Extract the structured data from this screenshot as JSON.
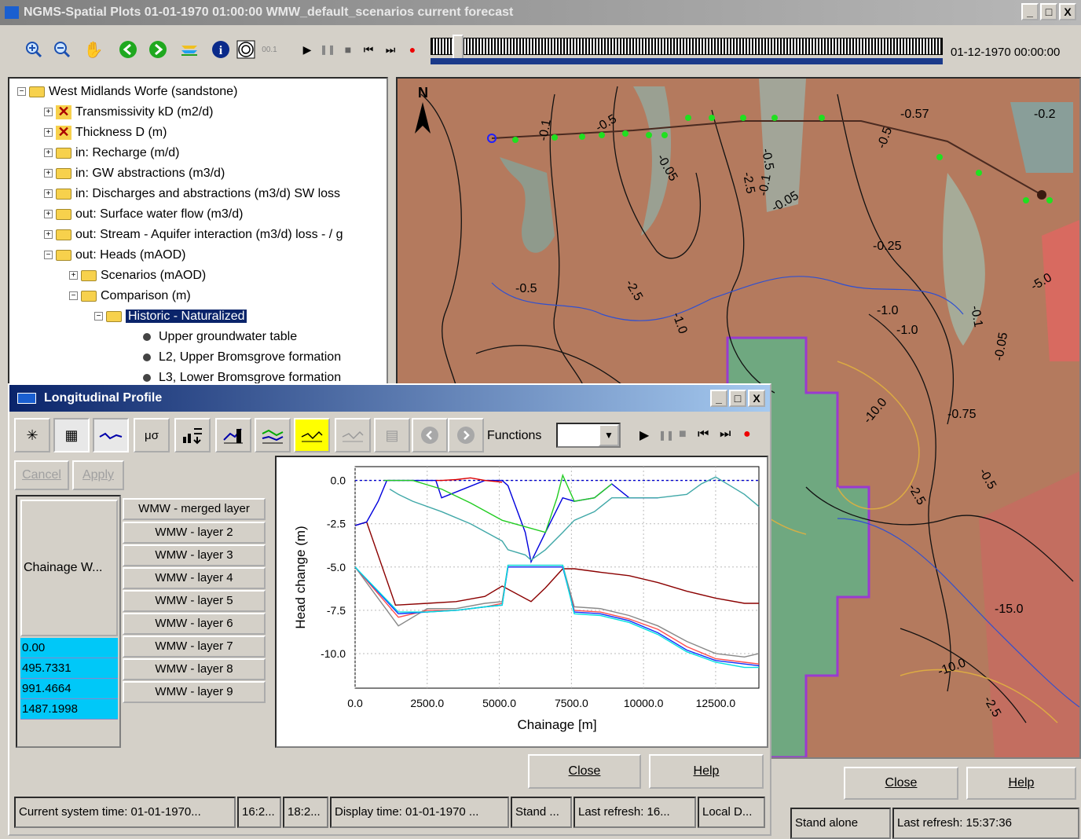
{
  "window": {
    "title": "NGMS-Spatial Plots 01-01-1970 01:00:00 WMW_default_scenarios current forecast",
    "minimize": "_",
    "maximize": "□",
    "close": "X"
  },
  "toolbar": {
    "end_date": "01-12-1970 00:00:00",
    "scale_label": "00.1"
  },
  "tree": {
    "root": "West Midlands Worfe (sandstone)",
    "items": [
      {
        "label": "Transmissivity kD (m2/d)"
      },
      {
        "label": "Thickness D (m)"
      },
      {
        "label": "in: Recharge (m/d)"
      },
      {
        "label": "in: GW abstractions (m3/d)"
      },
      {
        "label": "in: Discharges and abstractions (m3/d) SW loss"
      },
      {
        "label": "out: Surface water flow (m3/d)"
      },
      {
        "label": "out: Stream - Aquifer interaction (m3/d) loss - / g"
      },
      {
        "label": "out: Heads (mAOD)"
      },
      {
        "label": "Scenarios (mAOD)"
      },
      {
        "label": "Comparison (m)"
      },
      {
        "label": "Historic - Naturalized"
      },
      {
        "label": "Upper groundwater table"
      },
      {
        "label": "L2, Upper Bromsgrove formation"
      },
      {
        "label": "L3, Lower Bromsgrove formation"
      }
    ]
  },
  "map": {
    "north": "N",
    "labels": [
      "-0.1",
      "-0.5",
      "-0.05",
      "-0.5",
      "-2.5",
      "-0.1",
      "-0.05",
      "-0.5",
      "-0.57",
      "-0.2",
      "-0.25",
      "-0.5",
      "-2.5",
      "-1.0",
      "-1.0",
      "-1.0",
      "-10.0",
      "-0.75",
      "-5.0",
      "-15.0",
      "-10.0",
      "-2.5",
      "-0.05",
      "-0.1",
      "-0.5",
      "-2.5"
    ]
  },
  "profile": {
    "title": "Longitudinal Profile",
    "functions_label": "Functions",
    "cancel": "Cancel",
    "apply": "Apply",
    "column_header": "Chainage W...",
    "chainage_values": [
      "0.00",
      "495.7331",
      "991.4664",
      "1487.1998"
    ],
    "layers": [
      "WMW - merged layer",
      "WMW - layer 2",
      "WMW - layer 3",
      "WMW - layer 4",
      "WMW - layer 5",
      "WMW - layer 6",
      "WMW - layer 7",
      "WMW - layer 8",
      "WMW - layer 9"
    ],
    "close": "Close",
    "help": "Help"
  },
  "main_buttons": {
    "close": "Close",
    "help": "Help"
  },
  "status": {
    "system_time": "Current system time: 01-01-1970...",
    "t1": "16:2...",
    "t2": "18:2...",
    "display_time": "Display time: 01-01-1970 ...",
    "stand_short": "Stand ...",
    "last_refresh_short": "Last refresh: 16...",
    "local": "Local D...",
    "stand_alone": "Stand alone",
    "last_refresh": "Last refresh: 15:37:36"
  },
  "chart_data": {
    "type": "line",
    "xlabel": "Chainage [m]",
    "ylabel": "Head change (m)",
    "xlim": [
      0,
      14000
    ],
    "ylim": [
      -12,
      0.8
    ],
    "xticks": [
      0,
      2500,
      5000,
      7500,
      10000,
      12500
    ],
    "xtick_labels": [
      "0.0",
      "2500.0",
      "5000.0",
      "7500.0",
      "10000.0",
      "12500.0"
    ],
    "yticks": [
      0,
      -2.5,
      -5,
      -7.5,
      -10
    ],
    "ytick_labels": [
      "0.0",
      "-2.5",
      "-5.0",
      "-7.5",
      "-10.0"
    ],
    "grid": true,
    "series": [
      {
        "color": "#0000cc",
        "dashed": true,
        "x": [
          0,
          14000
        ],
        "y": [
          0,
          0
        ]
      },
      {
        "color": "#8b0000",
        "x": [
          0,
          400,
          1400,
          2500,
          3500,
          4500,
          5100,
          6100,
          6600,
          7200,
          7600,
          8500,
          9500,
          10500,
          11500,
          12500,
          13500,
          14000
        ],
        "y": [
          -2.6,
          -2.4,
          -7.2,
          -7.1,
          -7.0,
          -6.7,
          -6.1,
          -7.0,
          -6.2,
          -5.1,
          -5.1,
          -5.3,
          -5.5,
          -5.9,
          -6.4,
          -6.8,
          -7.1,
          -7.1
        ]
      },
      {
        "color": "#0000dd",
        "x": [
          0,
          400,
          800,
          1100,
          2500,
          2800,
          3000,
          4500,
          5100,
          5300,
          5900,
          6100,
          6600,
          7200,
          7600,
          8300,
          8900,
          9500,
          10500
        ],
        "y": [
          -2.6,
          -2.4,
          -1.2,
          0,
          0,
          0,
          -1.0,
          0,
          0,
          -0.3,
          -3.0,
          -4.7,
          -3.0,
          -1.0,
          -1.2,
          -1.0,
          -0.2,
          -1.0,
          -1.0
        ]
      },
      {
        "color": "#dd0000",
        "x": [
          2800,
          3000,
          3500,
          4000,
          4500,
          5100
        ],
        "y": [
          0,
          0,
          0.05,
          0.15,
          0,
          -0.1
        ]
      },
      {
        "color": "#22cc22",
        "x": [
          1000,
          1500,
          2000,
          3000,
          4000,
          5100,
          6600,
          7000,
          7200,
          7600,
          8300,
          8900
        ],
        "y": [
          0,
          0,
          0,
          -0.5,
          -1.3,
          -2.3,
          -3.0,
          -1.0,
          0.3,
          -1.2,
          -1.0,
          -0.2
        ]
      },
      {
        "color": "#40a8a8",
        "x": [
          1200,
          1500,
          2000,
          3000,
          4000,
          5100,
          5300,
          5900,
          6100,
          6600,
          7200,
          7600,
          8300,
          8900,
          9500,
          10500,
          11500,
          12000,
          12500,
          13000,
          13500,
          14000
        ],
        "y": [
          -0.5,
          -0.8,
          -1.2,
          -1.8,
          -2.5,
          -3.5,
          -4.0,
          -4.3,
          -4.6,
          -4.0,
          -3.0,
          -2.3,
          -1.8,
          -1.0,
          -1.0,
          -1.0,
          -0.8,
          -0.2,
          0.2,
          -0.3,
          -0.8,
          -1.5
        ]
      },
      {
        "color": "#888888",
        "x": [
          0,
          1500,
          2500,
          3500,
          4500,
          5100,
          5300,
          7200,
          7600,
          8500,
          9500,
          10500,
          11500,
          12500,
          13500,
          14000
        ],
        "y": [
          -5.0,
          -8.4,
          -7.4,
          -7.4,
          -7.1,
          -7.0,
          -4.9,
          -4.9,
          -7.3,
          -7.4,
          -7.8,
          -8.4,
          -9.3,
          -10.0,
          -10.2,
          -10.0
        ]
      },
      {
        "color": "#ff5050",
        "x": [
          0,
          1500,
          2500,
          3500,
          4500,
          5100,
          5300,
          7200,
          7600,
          8500,
          9500,
          10500,
          11500,
          12500,
          13500,
          14000
        ],
        "y": [
          -5.0,
          -7.9,
          -7.5,
          -7.5,
          -7.3,
          -7.1,
          -5.0,
          -5.0,
          -7.5,
          -7.6,
          -8.0,
          -8.6,
          -9.6,
          -10.3,
          -10.5,
          -10.6
        ]
      },
      {
        "color": "#1030ff",
        "x": [
          0,
          1500,
          2500,
          3500,
          4500,
          5100,
          5300,
          7200,
          7600,
          8500,
          9500,
          10500,
          11500,
          12500,
          13500,
          14000
        ],
        "y": [
          -5.0,
          -7.7,
          -7.6,
          -7.5,
          -7.3,
          -7.2,
          -5.0,
          -5.0,
          -7.6,
          -7.7,
          -8.1,
          -8.8,
          -9.8,
          -10.4,
          -10.6,
          -10.7
        ]
      },
      {
        "color": "#00e0e0",
        "x": [
          0,
          1500,
          2500,
          3500,
          4500,
          5100,
          5300,
          7200,
          7600,
          8500,
          9500,
          10500,
          11500,
          12500,
          13500,
          14000
        ],
        "y": [
          -5.0,
          -7.6,
          -7.6,
          -7.5,
          -7.3,
          -7.2,
          -4.9,
          -4.9,
          -7.7,
          -7.8,
          -8.2,
          -8.9,
          -9.9,
          -10.5,
          -10.8,
          -10.8
        ]
      }
    ]
  }
}
